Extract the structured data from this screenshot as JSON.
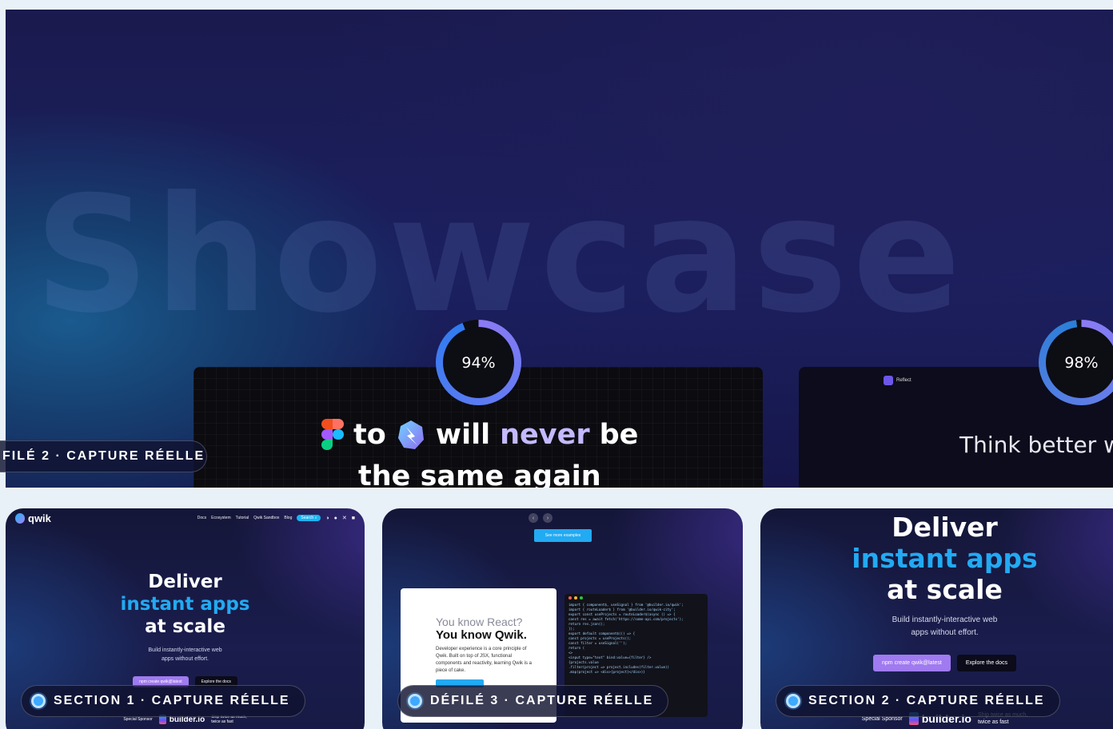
{
  "hero": {
    "watermark": "Showcase",
    "score_a": "94%",
    "score_b": "98%",
    "headline_word_to": "to",
    "headline_will": "will",
    "headline_never": "never",
    "headline_be": "be",
    "headline_line2": "the same again",
    "right_card_text": "Think better wit",
    "right_card_app": "Reflect"
  },
  "badges": {
    "hero_badge": "FILÉ 2 · CAPTURE RÉELLE",
    "thumb1_badge": "SECTION 1 · CAPTURE RÉELLE",
    "thumb2_badge": "DÉFILÉ 3 · CAPTURE RÉELLE",
    "thumb3_badge": "SECTION 2 · CAPTURE RÉELLE"
  },
  "site": {
    "brand": "qwik",
    "nav_links": [
      "Docs",
      "Ecosystem",
      "Tutorial",
      "Qwik Sandbox",
      "Blog"
    ],
    "search_label": "Search",
    "nav_icons": [
      "theme-icon",
      "github-icon",
      "x-icon",
      "discord-icon"
    ],
    "headline_1": "Deliver",
    "headline_2": "instant apps",
    "headline_3": "at scale",
    "subtitle_line1": "Build instantly-interactive web",
    "subtitle_line2": "apps without effort.",
    "btn_npm": "npm create qwik@latest",
    "btn_docs": "Explore the docs",
    "sponsor_label": "Special Sponsor",
    "sponsor_name": "builder.io",
    "sponsor_tag_1": "Ship twice as much,",
    "sponsor_tag_2": "twice as fast"
  },
  "showcase": {
    "see_more": "See more examples",
    "q1": "You know React?",
    "q2": "You know Qwik.",
    "para": "Developer experience is a core principle of Qwik. Built on top of JSX, functional components and reactivity, learning Qwik is a piece of cake.",
    "code_lines": [
      "import { component$, useSignal } from '@builder.io/qwik';",
      "import { routeLoader$ } from '@builder.io/qwik-city';",
      "",
      "export const useProjects = routeLoader$(async () => {",
      "  const res = await fetch('https://some-api.com/projects');",
      "  return res.json();",
      "});",
      "",
      "export default component$(() => {",
      "  const projects = useProjects();",
      "  const filter = useSignal('');",
      "  return (",
      "    <>",
      "      <input type=\"text\" bind:value={filter} />",
      "      {projects.value",
      "        .filter(project => project.includes(filter.value))",
      "        .map(project => <div>{project}</div>)}"
    ]
  },
  "colors": {
    "accent_blue": "#22aaf2",
    "accent_purple": "#a07af0",
    "ring_a": "#2f7bf0",
    "ring_b": "#2a7fd6"
  }
}
